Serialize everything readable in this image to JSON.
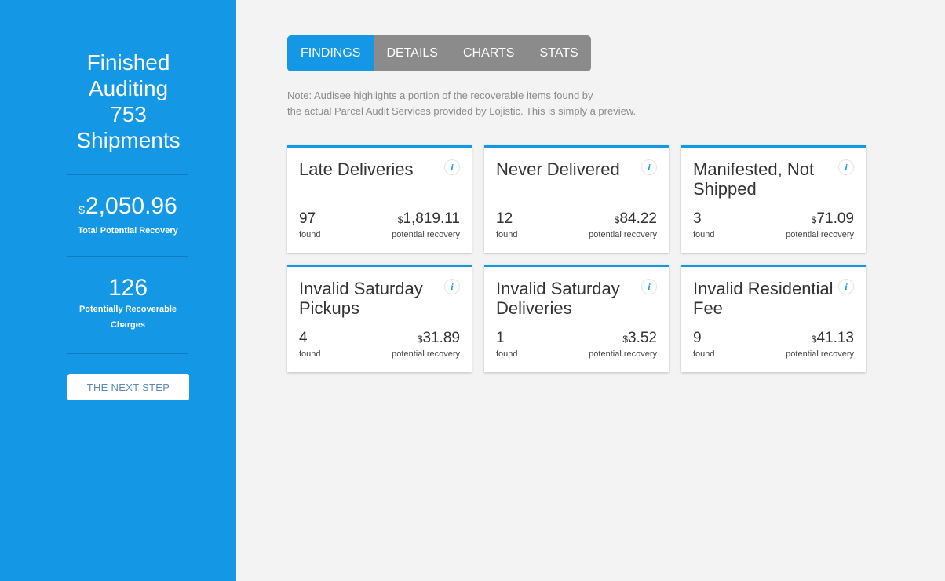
{
  "sidebar": {
    "title_lines": [
      "Finished",
      "Auditing",
      "753",
      "Shipments"
    ],
    "total_recovery": {
      "currency": "$",
      "value": "2,050.96",
      "label": "Total Potential Recovery"
    },
    "recoverable_charges": {
      "value": "126",
      "label_lines": [
        "Potentially Recoverable",
        "Charges"
      ]
    },
    "next_step_label": "THE NEXT STEP"
  },
  "tabs": [
    {
      "label": "FINDINGS",
      "active": true
    },
    {
      "label": "DETAILS",
      "active": false
    },
    {
      "label": "CHARTS",
      "active": false
    },
    {
      "label": "STATS",
      "active": false
    }
  ],
  "note_lines": [
    "Note: Audisee highlights a portion of the recoverable items found by",
    "the actual Parcel Audit Services provided by Lojistic. This is simply a preview."
  ],
  "cards": [
    {
      "title_lines": [
        "Late Deliveries"
      ],
      "count": "97",
      "count_label": "found",
      "currency": "$",
      "recovery": "1,819.11",
      "recovery_label": "potential recovery",
      "info_icon": "i"
    },
    {
      "title_lines": [
        "Never Delivered"
      ],
      "count": "12",
      "count_label": "found",
      "currency": "$",
      "recovery": "84.22",
      "recovery_label": "potential recovery",
      "info_icon": "i"
    },
    {
      "title_lines": [
        "Manifested, Not",
        "Shipped"
      ],
      "count": "3",
      "count_label": "found",
      "currency": "$",
      "recovery": "71.09",
      "recovery_label": "potential recovery",
      "info_icon": "i"
    },
    {
      "title_lines": [
        "Invalid Saturday",
        "Pickups"
      ],
      "count": "4",
      "count_label": "found",
      "currency": "$",
      "recovery": "31.89",
      "recovery_label": "potential recovery",
      "info_icon": "i"
    },
    {
      "title_lines": [
        "Invalid Saturday",
        "Deliveries"
      ],
      "count": "1",
      "count_label": "found",
      "currency": "$",
      "recovery": "3.52",
      "recovery_label": "potential recovery",
      "info_icon": "i"
    },
    {
      "title_lines": [
        "Invalid Residential",
        "Fee"
      ],
      "count": "9",
      "count_label": "found",
      "currency": "$",
      "recovery": "41.13",
      "recovery_label": "potential recovery",
      "info_icon": "i"
    }
  ],
  "colors": {
    "accent": "#1498e6",
    "tab_inactive": "#8b8b8b",
    "background": "#f3f3f3"
  }
}
